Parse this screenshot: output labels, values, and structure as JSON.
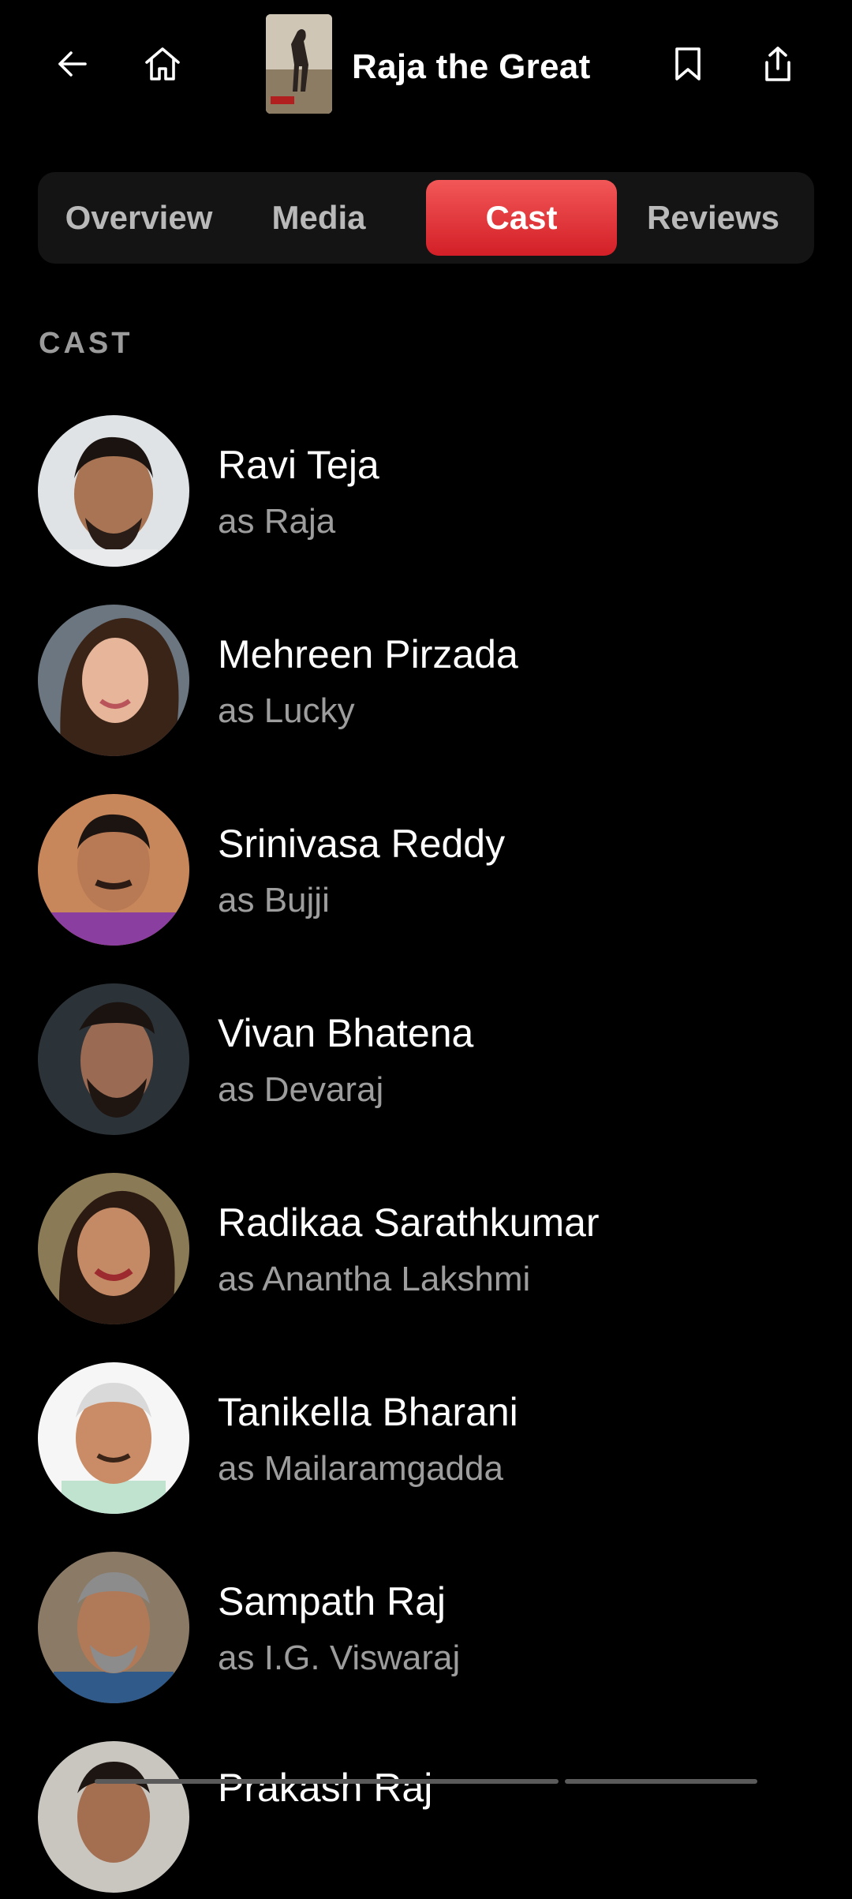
{
  "header": {
    "title": "Raja the Great",
    "back_icon": "arrow-left-icon",
    "home_icon": "home-icon",
    "bookmark_icon": "bookmark-icon",
    "share_icon": "share-icon"
  },
  "tabs": [
    {
      "label": "Overview",
      "active": false
    },
    {
      "label": "Media",
      "active": false
    },
    {
      "label": "Cast",
      "active": true
    },
    {
      "label": "Reviews",
      "active": false
    }
  ],
  "section": {
    "label": "CAST"
  },
  "cast": [
    {
      "name": "Ravi Teja",
      "role": "as Raja"
    },
    {
      "name": "Mehreen Pirzada",
      "role": "as Lucky"
    },
    {
      "name": "Srinivasa Reddy",
      "role": "as Bujji"
    },
    {
      "name": "Vivan Bhatena",
      "role": "as Devaraj"
    },
    {
      "name": "Radikaa Sarathkumar",
      "role": "as Anantha Lakshmi"
    },
    {
      "name": "Tanikella Bharani",
      "role": "as Mailaramgadda"
    },
    {
      "name": "Sampath Raj",
      "role": "as I.G. Viswaraj"
    },
    {
      "name": "Prakash Raj",
      "role": ""
    }
  ],
  "colors": {
    "background": "#000000",
    "active_tab": "#e23a3f",
    "tab_bar": "#141414",
    "secondary_text": "#9d9d9d"
  }
}
